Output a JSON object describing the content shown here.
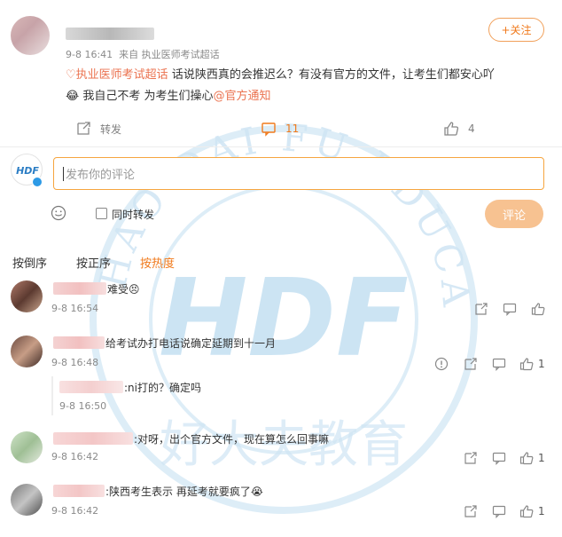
{
  "post": {
    "time": "9-8 16:41",
    "source": "来自 执业医师考试超话",
    "topic_link": "执业医师考试超话",
    "body_line1": "话说陕西真的会推迟么？有没有官方的文件，让考生们都安心吖",
    "body_line2_pre": "我自己不考 为考生们操心",
    "mention": "@官方通知",
    "follow_label": "+关注",
    "repost_label": "转发",
    "comment_count": "11",
    "like_count": "4"
  },
  "composer": {
    "placeholder": "发布你的评论",
    "also_repost_label": "同时转发",
    "submit_label": "评论"
  },
  "sort_tabs": [
    "按倒序",
    "按正序",
    "按热度"
  ],
  "comments": [
    {
      "text": "难受😣",
      "time": "9-8 16:54",
      "likes": ""
    },
    {
      "text": "给考试办打电话说确定延期到十一月",
      "time": "9-8 16:48",
      "likes": "1",
      "reply": {
        "text": ":ni打的？确定吗",
        "time": "9-8 16:50"
      }
    },
    {
      "text": ":对呀，出个官方文件，现在算怎么回事嘛",
      "time": "9-8 16:42",
      "likes": "1"
    },
    {
      "text": ":陕西考生表示 再延考就要疯了😭",
      "time": "9-8 16:42",
      "likes": "1"
    }
  ],
  "watermark": {
    "logo_text": "HDF",
    "ring_text": "HAO DAI FU EDUCATION",
    "cn_text": "好大夫教育"
  },
  "colors": {
    "accent": "#f07a1c",
    "link": "#eb7350",
    "watermark": "#bcdcf0"
  }
}
